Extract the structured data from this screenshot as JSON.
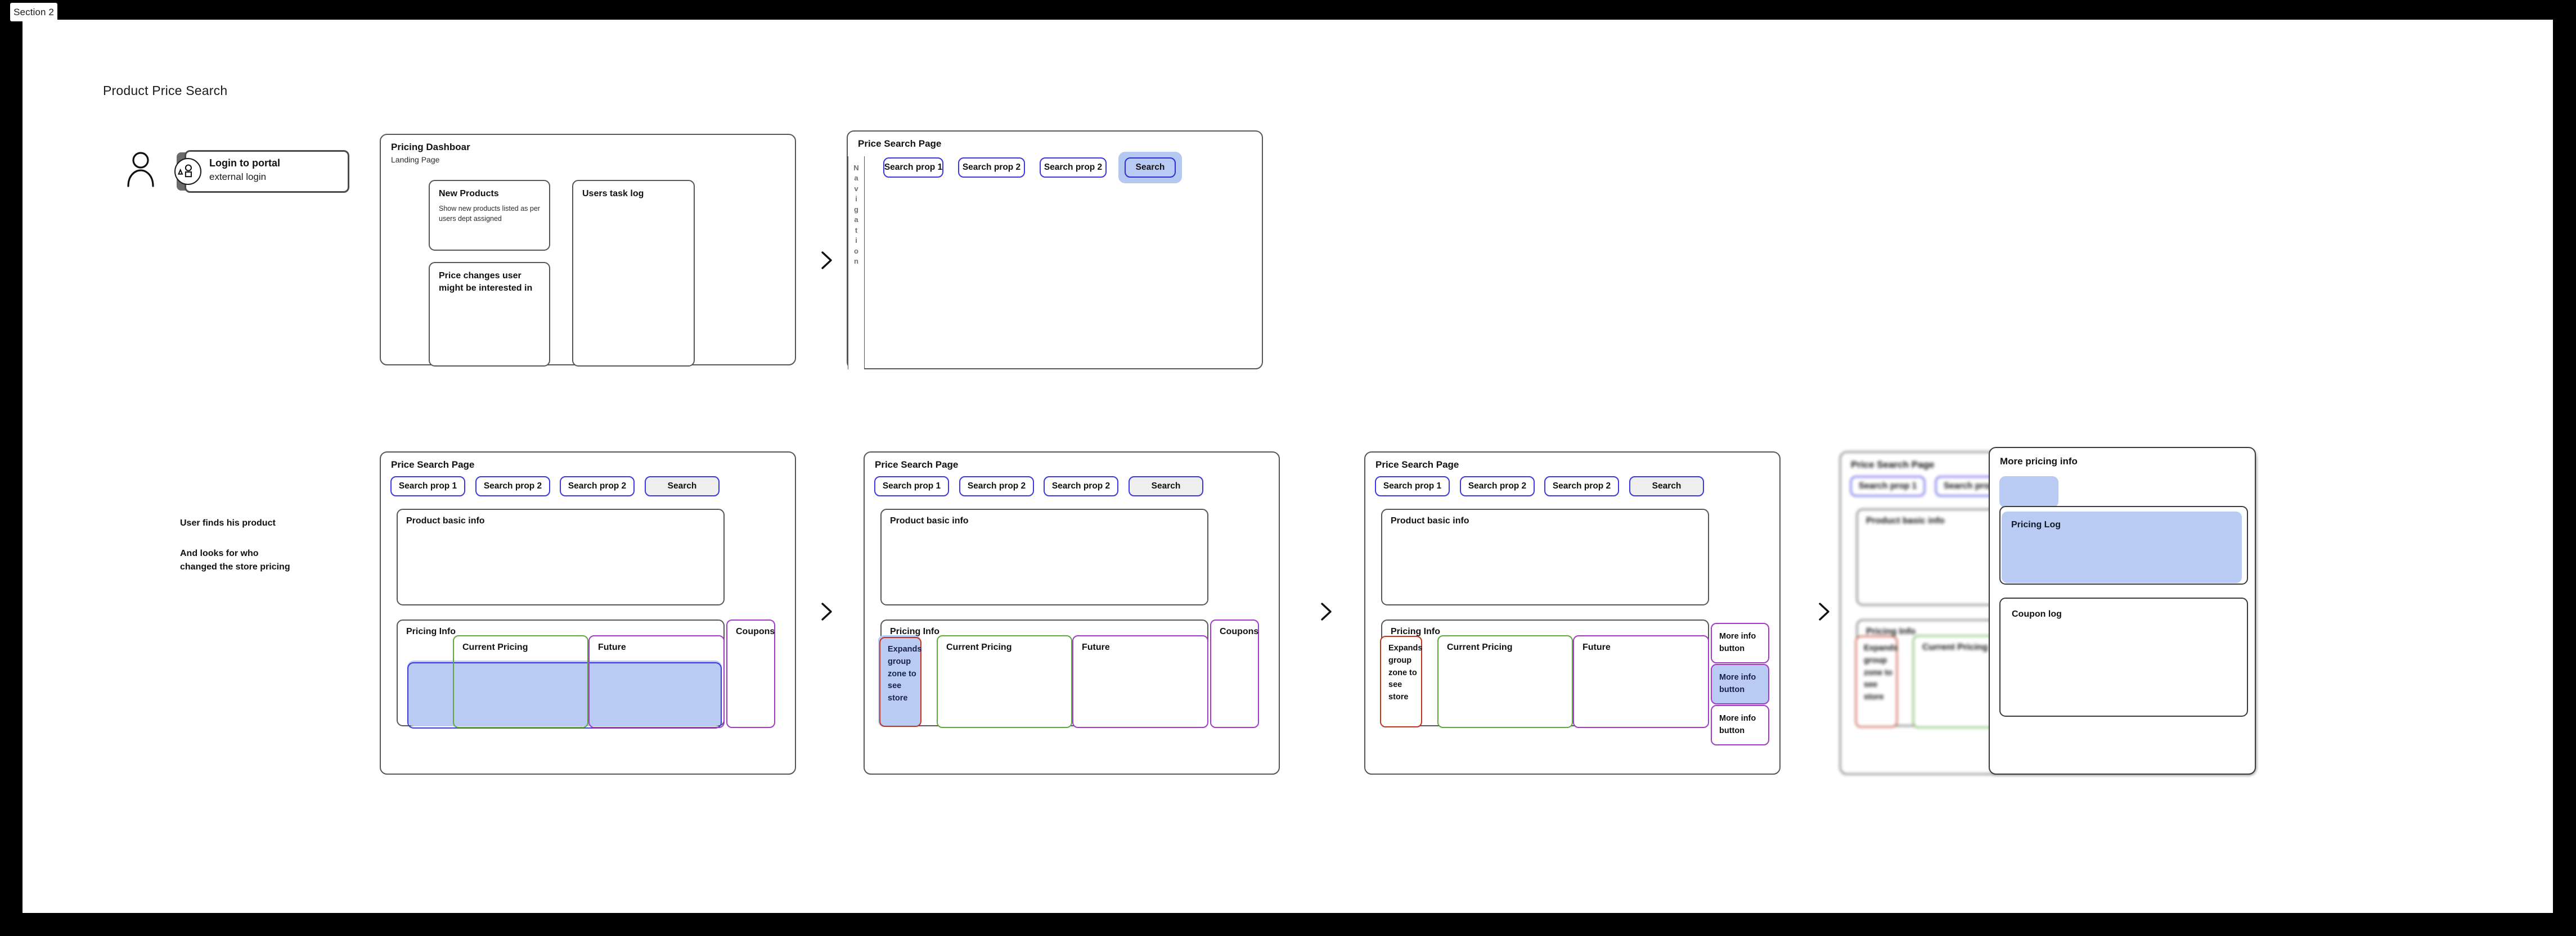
{
  "section_tab": {
    "label": "Section 2"
  },
  "page_title": "Product Price Search",
  "actor": {
    "icon": "user-icon"
  },
  "login_node": {
    "icon": "shapes-icon",
    "title": "Login to portal",
    "subtitle": "external login"
  },
  "notes": {
    "find_product": "User finds his product",
    "looks_for_changes": "And looks for who\nchanged the store pricing"
  },
  "pricing_dashboard": {
    "title": "Pricing Dashboar",
    "subtitle": "Landing Page",
    "new_products": {
      "title": "New Products",
      "description": "Show new products listed as per users dept assigned"
    },
    "price_changes": {
      "title": "Price changes user\nmight be interested in"
    },
    "users_task_log": {
      "title": "Users task log"
    }
  },
  "price_search_page": {
    "title": "Price Search Page",
    "nav_label": "Navigation",
    "search_props": [
      "Search prop 1",
      "Search prop 2",
      "Search prop 2"
    ],
    "search_button": "Search",
    "product_basic_info": "Product basic info",
    "pricing_info": "Pricing Info",
    "expands_group": "Expands group zone to see store",
    "current_pricing": "Current Pricing",
    "future": "Future",
    "coupons": "Coupons",
    "more_info_buttons": [
      "More info button",
      "More info button",
      "More info button"
    ]
  },
  "more_pricing_info": {
    "title": "More pricing info",
    "pricing_log": "Pricing Log",
    "coupon_log": "Coupon log"
  },
  "arrows": {
    "glyph": "chevron-right"
  },
  "colors": {
    "accent_blue": "#3d37e0",
    "selection_blue": "#b9cbf2",
    "green_zone": "#5aaa3c",
    "purple_zone": "#a43bc7",
    "red_zone": "#c0341d",
    "frame_gray": "#565656",
    "canvas": "#ffffff",
    "backdrop": "#000000"
  }
}
